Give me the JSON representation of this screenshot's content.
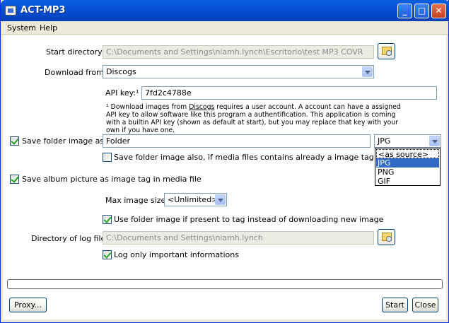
{
  "window": {
    "title": "ACT-MP3",
    "min_glyph": "_",
    "max_glyph": "□",
    "close_glyph": "✕"
  },
  "menu": {
    "items": [
      "System",
      "Help"
    ]
  },
  "start_directory": {
    "label": "Start directory:",
    "value": "C:\\Documents and Settings\\niamh.lynch\\Escritorio\\test MP3 COVR"
  },
  "download_from": {
    "label": "Download from:",
    "value": "Discogs"
  },
  "api_key": {
    "label": "API key:",
    "superscript": "¹",
    "value": "7fd2c4788e",
    "note_prefix": "¹ Download images from ",
    "note_link": "Discogs",
    "note_rest": " requires a user account. A account can have a assigned API key to allow software like this program a authentification. This application is coming with a builtin API key (shown as default at start), but you may replace that key with your own if you have one."
  },
  "save_folder_image": {
    "label": "Save folder image as:",
    "checked": true,
    "name_value": "Folder",
    "format_value": "JPG",
    "format_options": [
      "<as source>",
      "JPG",
      "PNG",
      "GIF"
    ],
    "also_label": "Save folder image also, if media files contains already a image tag",
    "also_checked": false
  },
  "save_album_picture": {
    "label": "Save album picture as image tag in media file",
    "checked": true
  },
  "max_image_size": {
    "label": "Max image size:",
    "value": "<Unlimited>"
  },
  "use_folder_image": {
    "label": "Use folder image if present to tag instead of downloading new image",
    "checked": true
  },
  "log_directory": {
    "label": "Directory of log file:",
    "value": "C:\\Documents and Settings\\niamh.lynch"
  },
  "log_important": {
    "label": "Log only important informations",
    "checked": true
  },
  "buttons": {
    "proxy": "Proxy...",
    "start": "Start",
    "close": "Close"
  },
  "colors": {
    "titlebar": "#0550d6",
    "window_bg": "#ece9d8",
    "selection": "#316ac5",
    "check_green": "#21a121"
  }
}
